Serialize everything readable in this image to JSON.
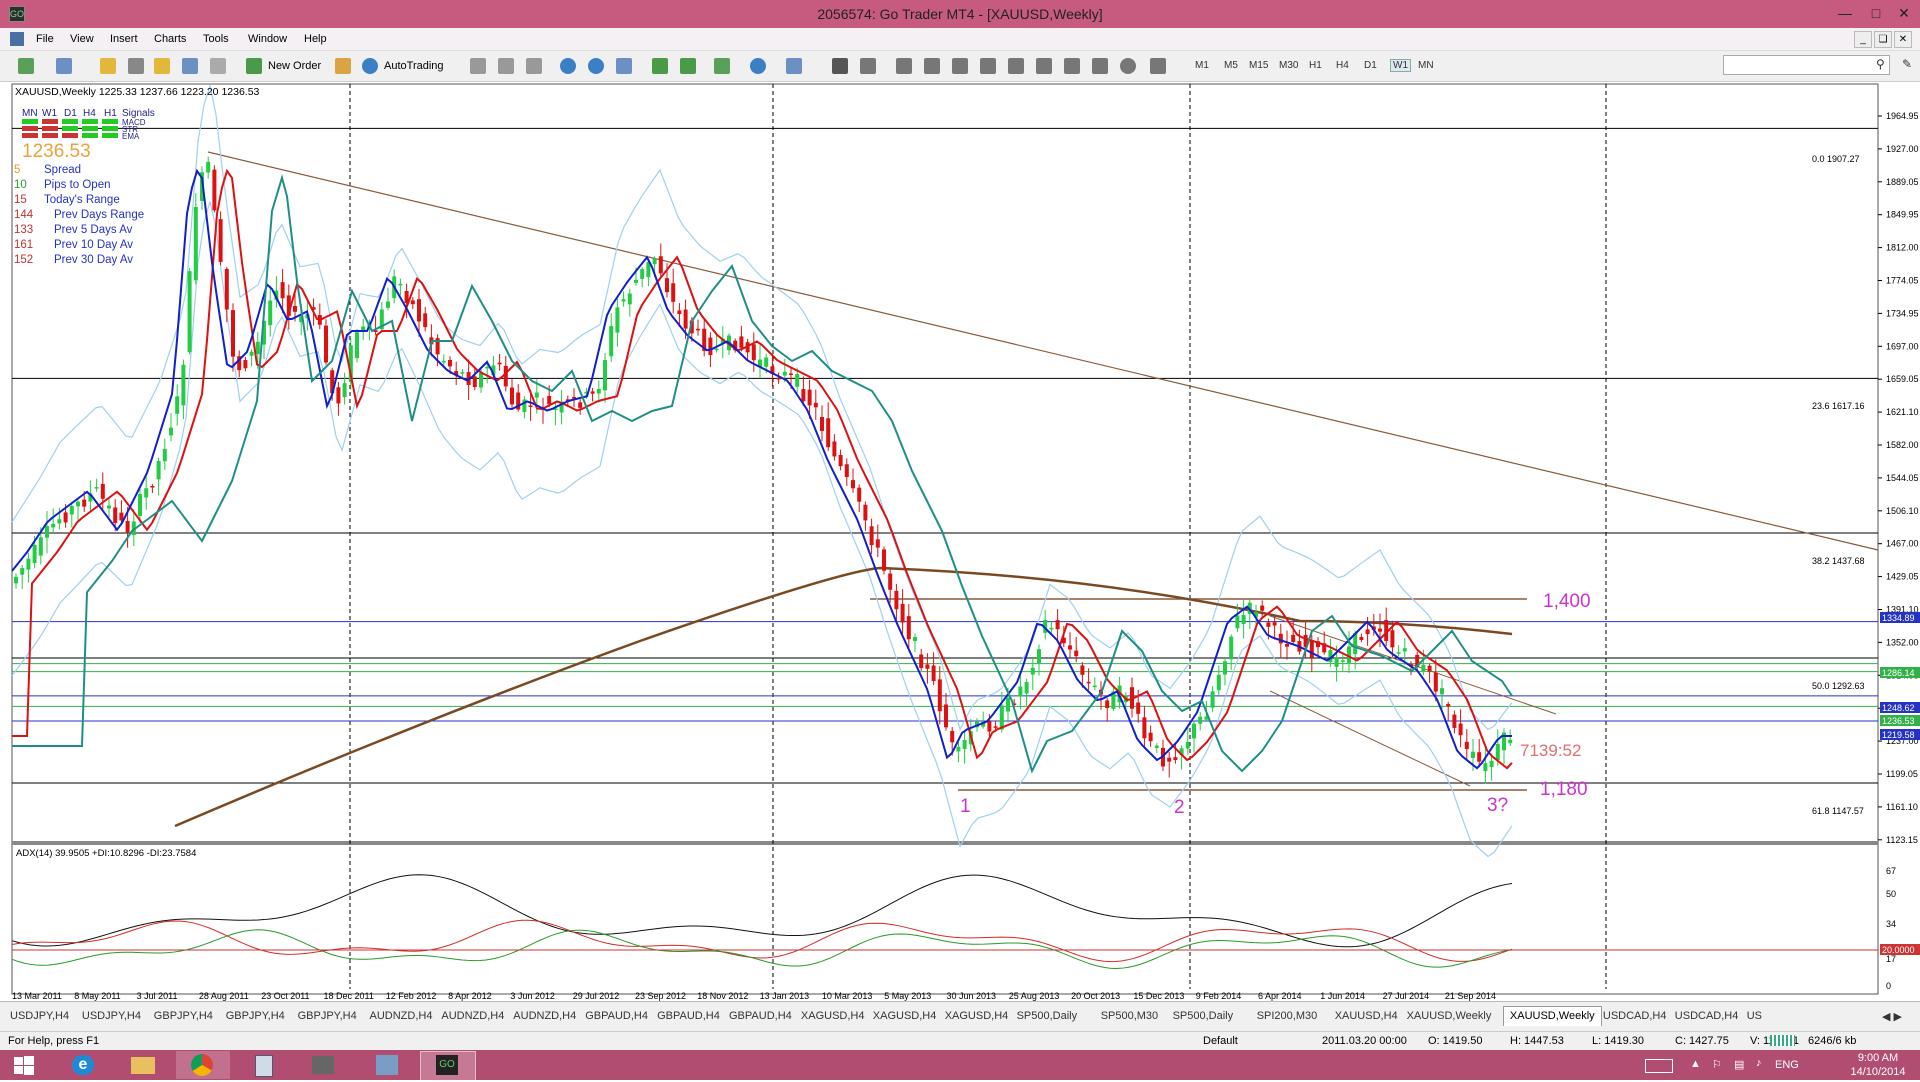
{
  "window": {
    "title": "2056574: Go Trader MT4 - [XAUUSD,Weekly]",
    "app_icon": "GO",
    "controls": [
      "minimize-icon",
      "maximize-icon",
      "close-icon"
    ]
  },
  "menu": {
    "items": [
      "File",
      "View",
      "Insert",
      "Charts",
      "Tools",
      "Window",
      "Help"
    ]
  },
  "toolbar": {
    "new_order": "New Order",
    "autotrading": "AutoTrading",
    "timeframes": [
      "M1",
      "M5",
      "M15",
      "M30",
      "H1",
      "H4",
      "D1",
      "W1",
      "MN"
    ],
    "active_timeframe": "W1"
  },
  "chart": {
    "header": "XAUUSD,Weekly  1225.33 1237.66 1223.20 1236.53",
    "signals": {
      "cols": [
        "MN",
        "W1",
        "D1",
        "H4",
        "H1"
      ],
      "label": "Signals",
      "rows": [
        "MACD",
        "STR",
        "EMA"
      ]
    },
    "price": "1236.53",
    "info_rows": [
      {
        "value": "5",
        "label": "Spread"
      },
      {
        "value": "10",
        "label": "Pips to Open"
      },
      {
        "value": "15",
        "label": "Today's Range"
      },
      {
        "value": "144",
        "label": "Prev Days Range"
      },
      {
        "value": "133",
        "label": "Prev 5 Days Av"
      },
      {
        "value": "161",
        "label": "Prev 10 Day Av"
      },
      {
        "value": "152",
        "label": "Prev 30 Day Av"
      }
    ],
    "price_axis": [
      "1964.95",
      "1927.00",
      "1889.05",
      "1849.95",
      "1812.00",
      "1774.05",
      "1734.95",
      "1697.00",
      "1659.05",
      "1621.10",
      "1582.00",
      "1544.05",
      "1506.10",
      "1467.00",
      "1429.05",
      "1391.10",
      "1352.00",
      "1314.05",
      "1276.10",
      "1237.00",
      "1199.05",
      "1161.10",
      "1123.15"
    ],
    "price_tags": [
      {
        "value": "1334.89",
        "color": "#2433c4"
      },
      {
        "value": "1286.14",
        "color": "#33b04a"
      },
      {
        "value": "1248.62",
        "color": "#2433c4"
      },
      {
        "value": "1236.53",
        "color": "#33b04a"
      },
      {
        "value": "1219.58",
        "color": "#2433c4"
      }
    ],
    "fib_levels": [
      "0.0 1907.27",
      "23.6 1617.16",
      "38.2 1437.68",
      "50.0 1292.63",
      "61.8 1147.57"
    ],
    "annotations": {
      "resistance": "1,400",
      "support": "1,180",
      "countdown": "7139:52",
      "point1": "1",
      "point2": "2",
      "point3": "3?"
    },
    "date_axis": [
      "13 Mar 2011",
      "8 May 2011",
      "3 Jul 2011",
      "28 Aug 2011",
      "23 Oct 2011",
      "18 Dec 2011",
      "12 Feb 2012",
      "8 Apr 2012",
      "3 Jun 2012",
      "29 Jul 2012",
      "23 Sep 2012",
      "18 Nov 2012",
      "13 Jan 2013",
      "10 Mar 2013",
      "5 May 2013",
      "30 Jun 2013",
      "25 Aug 2013",
      "20 Oct 2013",
      "15 Dec 2013",
      "9 Feb 2014",
      "6 Apr 2014",
      "1 Jun 2014",
      "27 Jul 2014",
      "21 Sep 2014"
    ]
  },
  "adx": {
    "header": "ADX(14) 39.9505 +DI:10.8296 -DI:23.7584",
    "axis": [
      "67",
      "50",
      "34",
      "20.0000",
      "17",
      "0"
    ]
  },
  "tabs": [
    "USDJPY,H4",
    "USDJPY,H4",
    "GBPJPY,H4",
    "GBPJPY,H4",
    "GBPJPY,H4",
    "AUDNZD,H4",
    "AUDNZD,H4",
    "AUDNZD,H4",
    "GBPAUD,H4",
    "GBPAUD,H4",
    "GBPAUD,H4",
    "XAGUSD,H4",
    "XAGUSD,H4",
    "XAGUSD,H4",
    "SP500,Daily",
    "SP500,M30",
    "SP500,Daily",
    "SPI200,M30",
    "XAUUSD,H4",
    "XAUUSD,Weekly",
    "XAUUSD,Weekly",
    "USDCAD,H4",
    "USDCAD,H4",
    "US"
  ],
  "active_tab_index": 20,
  "status": {
    "help": "For Help, press F1",
    "profile": "Default",
    "time": "2011.03.20 00:00",
    "open": "O: 1419.50",
    "high": "H: 1447.53",
    "low": "L: 1419.30",
    "close": "C: 1427.75",
    "volume": "V: 117821",
    "traffic": "6246/6 kb"
  },
  "taskbar": {
    "lang": "ENG",
    "time": "9:00 AM",
    "date": "14/10/2014"
  },
  "colors": {
    "titlebar": "#c75a7f",
    "taskbar": "#b24d72",
    "bull_candle": "#22cc44",
    "bear_candle": "#dd1111",
    "annotation": "#cc33cc",
    "trendline": "#8b5a3c"
  }
}
